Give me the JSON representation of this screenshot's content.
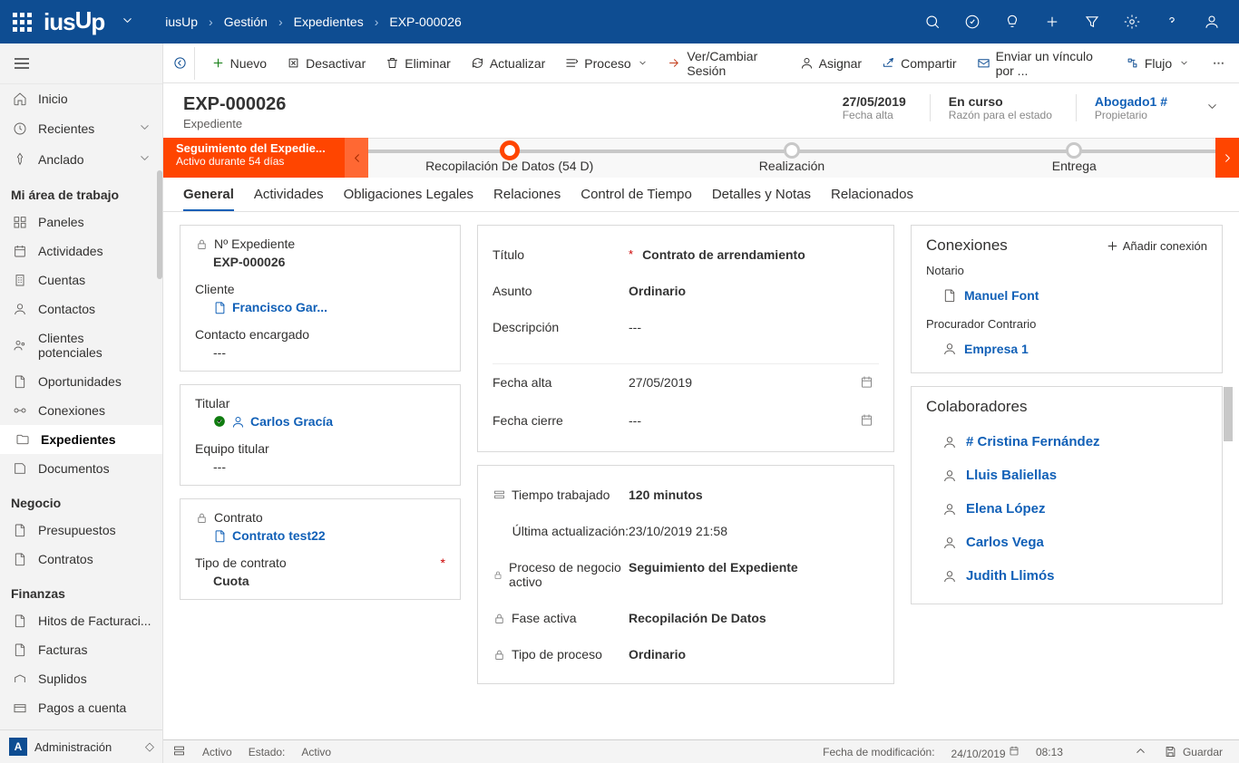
{
  "topbar": {
    "app": "iusUp",
    "breadcrumb": [
      "iusUp",
      "Gestión",
      "Expedientes",
      "EXP-000026"
    ]
  },
  "sidebar": {
    "top": [
      {
        "icon": "home",
        "label": "Inicio"
      },
      {
        "icon": "clock",
        "label": "Recientes",
        "chev": true
      },
      {
        "icon": "pin",
        "label": "Anclado",
        "chev": true
      }
    ],
    "workarea_title": "Mi área de trabajo",
    "items": [
      {
        "icon": "panel",
        "label": "Paneles"
      },
      {
        "icon": "activity",
        "label": "Actividades"
      },
      {
        "icon": "account",
        "label": "Cuentas"
      },
      {
        "icon": "person",
        "label": "Contactos"
      },
      {
        "icon": "lead",
        "label": "Clientes potenciales"
      },
      {
        "icon": "opp",
        "label": "Oportunidades"
      },
      {
        "icon": "conn",
        "label": "Conexiones"
      },
      {
        "icon": "folder",
        "label": "Expedientes",
        "active": true
      },
      {
        "icon": "doc",
        "label": "Documentos"
      }
    ],
    "negocio_title": "Negocio",
    "negocio": [
      {
        "icon": "money",
        "label": "Presupuestos"
      },
      {
        "icon": "contract",
        "label": "Contratos"
      }
    ],
    "finanzas_title": "Finanzas",
    "finanzas": [
      {
        "icon": "milestone",
        "label": "Hitos de Facturaci..."
      },
      {
        "icon": "invoice",
        "label": "Facturas"
      },
      {
        "icon": "supplied",
        "label": "Suplidos"
      },
      {
        "icon": "payment",
        "label": "Pagos a cuenta"
      }
    ],
    "admin_badge": "A",
    "admin_label": "Administración"
  },
  "commands": [
    {
      "icon": "plus",
      "label": "Nuevo",
      "color": "#107c10"
    },
    {
      "icon": "deactivate",
      "label": "Desactivar",
      "color": "#605e5c"
    },
    {
      "icon": "trash",
      "label": "Eliminar",
      "color": "#605e5c"
    },
    {
      "icon": "refresh",
      "label": "Actualizar",
      "color": "#605e5c"
    },
    {
      "icon": "process",
      "label": "Proceso",
      "color": "#605e5c",
      "chev": true
    },
    {
      "icon": "session",
      "label": "Ver/Cambiar Sesión",
      "color": "#605e5c"
    },
    {
      "icon": "assign",
      "label": "Asignar",
      "color": "#605e5c"
    },
    {
      "icon": "share",
      "label": "Compartir",
      "color": "#605e5c"
    },
    {
      "icon": "mail",
      "label": "Enviar un vínculo por ...",
      "color": "#605e5c"
    },
    {
      "icon": "flow",
      "label": "Flujo",
      "color": "#605e5c",
      "chev": true
    }
  ],
  "header": {
    "title": "EXP-000026",
    "subtitle": "Expediente",
    "date_value": "27/05/2019",
    "date_label": "Fecha alta",
    "status_value": "En curso",
    "status_label": "Razón para el estado",
    "owner_value": "Abogado1 #",
    "owner_label": "Propietario"
  },
  "stages": {
    "active_title": "Seguimiento del Expedie...",
    "active_sub": "Activo durante 54 días",
    "items": [
      {
        "label": "Recopilación De Datos  (54 D)",
        "current": true
      },
      {
        "label": "Realización"
      },
      {
        "label": "Entrega"
      }
    ]
  },
  "tabs": [
    "General",
    "Actividades",
    "Obligaciones Legales",
    "Relaciones",
    "Control de Tiempo",
    "Detalles y Notas",
    "Relacionados"
  ],
  "active_tab": "General",
  "panel1": {
    "num_label": "Nº Expediente",
    "num_value": "EXP-000026",
    "client_label": "Cliente",
    "client_value": "Francisco Gar...",
    "contact_label": "Contacto encargado",
    "contact_value": "---"
  },
  "panel2": {
    "titular_label": "Titular",
    "titular_value": "Carlos Gracía",
    "team_label": "Equipo titular",
    "team_value": "---"
  },
  "panel3": {
    "contract_label": "Contrato",
    "contract_value": "Contrato test22",
    "type_label": "Tipo de contrato",
    "type_value": "Cuota"
  },
  "panel4": {
    "title_label": "Título",
    "title_value": "Contrato de arrendamiento",
    "subject_label": "Asunto",
    "subject_value": "Ordinario",
    "desc_label": "Descripción",
    "desc_value": "---",
    "start_label": "Fecha alta",
    "start_value": "27/05/2019",
    "end_label": "Fecha cierre",
    "end_value": "---"
  },
  "panel5": {
    "time_label": "Tiempo trabajado",
    "time_value": "120 minutos",
    "upd_label": "Última actualización:",
    "upd_value": "23/10/2019 21:58",
    "proc_label": "Proceso de negocio activo",
    "proc_value": "Seguimiento del Expediente",
    "phase_label": "Fase activa",
    "phase_value": "Recopilación De Datos",
    "ptype_label": "Tipo de proceso",
    "ptype_value": "Ordinario"
  },
  "connections": {
    "title": "Conexiones",
    "add": "Añadir conexión",
    "notary_label": "Notario",
    "notary_value": "Manuel Font",
    "proc_label": "Procurador Contrario",
    "proc_value": "Empresa 1"
  },
  "collab": {
    "title": "Colaboradores",
    "items": [
      "# Cristina Fernández",
      "Lluis Baliellas",
      "Elena López",
      "Carlos Vega",
      "Judith Llimós"
    ]
  },
  "statusbar": {
    "activo1": "Activo",
    "estado": "Estado:",
    "activo2": "Activo",
    "mod_label": "Fecha de modificación:",
    "mod_date": "24/10/2019",
    "mod_time": "08:13",
    "save": "Guardar"
  }
}
